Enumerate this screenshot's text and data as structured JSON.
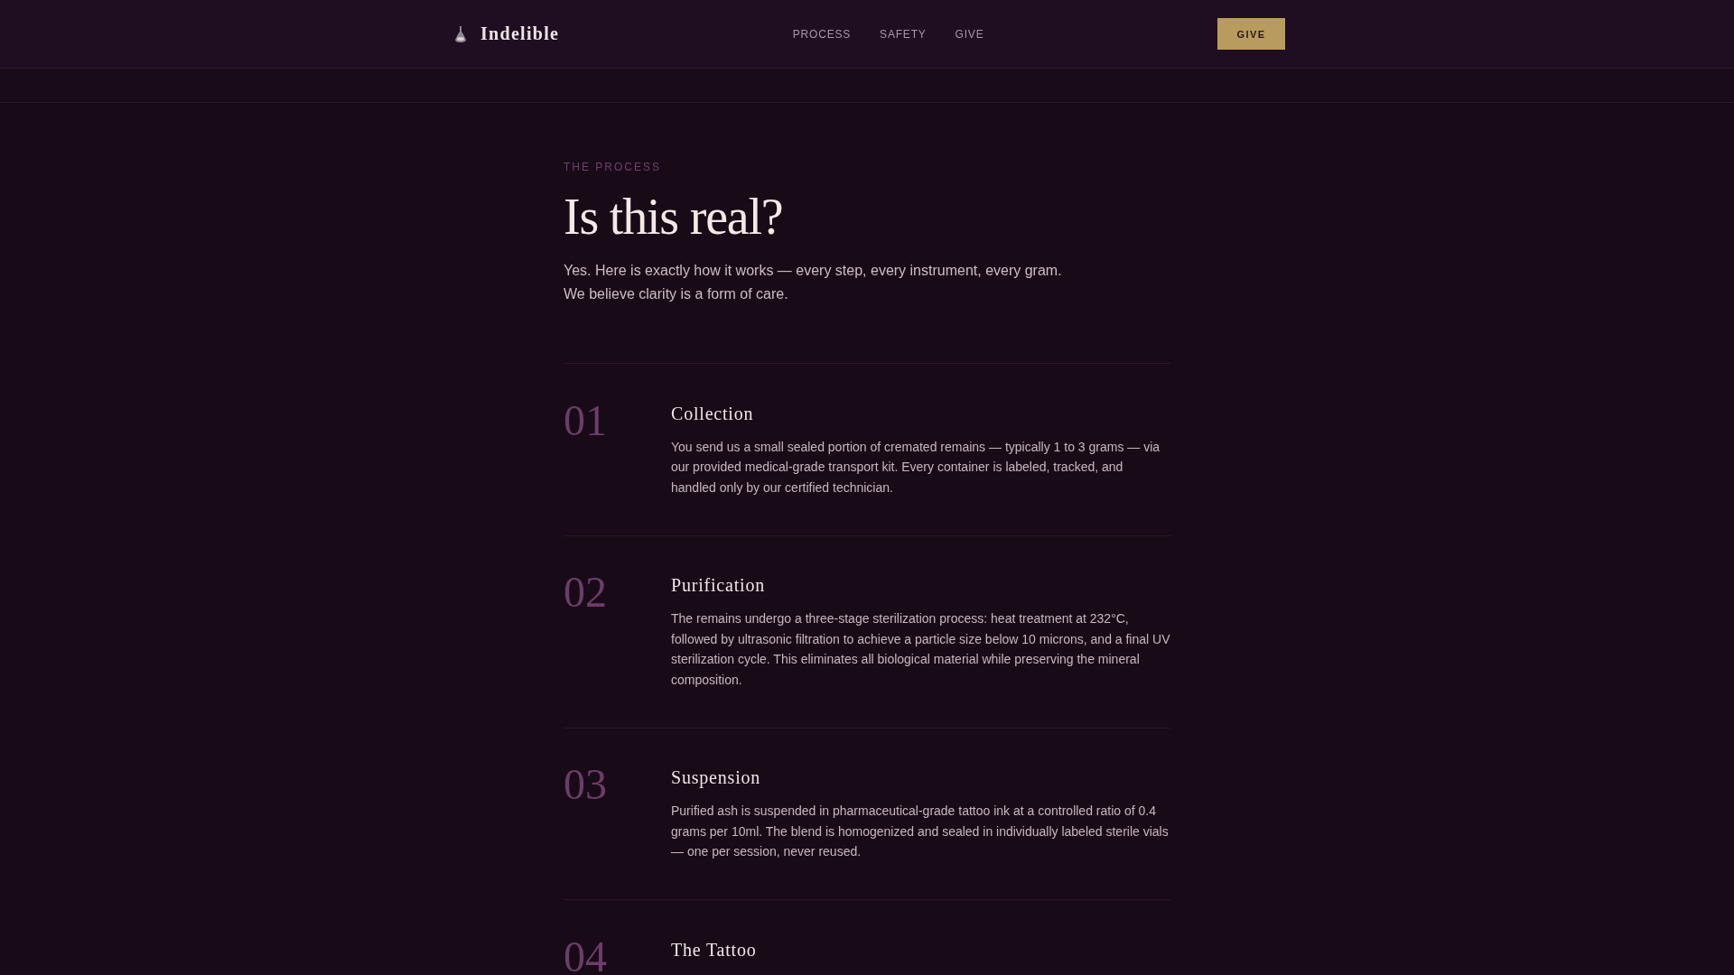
{
  "header": {
    "brand": "Indelible",
    "nav": [
      "PROCESS",
      "SAFETY",
      "GIVE"
    ],
    "cta": "GIVE"
  },
  "intro": {
    "eyebrow": "THE PROCESS",
    "title": "Is this real?",
    "lead": "Yes. Here is exactly how it works — every step, every instrument, every gram. We believe clarity is a form of care."
  },
  "steps": [
    {
      "number": "01",
      "title": "Collection",
      "body": "You send us a small sealed portion of cremated remains — typically 1 to 3 grams — via our provided medical-grade transport kit. Every container is labeled, tracked, and handled only by our certified technician."
    },
    {
      "number": "02",
      "title": "Purification",
      "body": "The remains undergo a three-stage sterilization process: heat treatment at 232°C, followed by ultrasonic filtration to achieve a particle size below 10 microns, and a final UV sterilization cycle. This eliminates all biological material while preserving the mineral composition."
    },
    {
      "number": "03",
      "title": "Suspension",
      "body": "Purified ash is suspended in pharmaceutical-grade tattoo ink at a controlled ratio of 0.4 grams per 10ml. The blend is homogenized and sealed in individually labeled sterile vials — one per session, never reused."
    },
    {
      "number": "04",
      "title": "The Tattoo"
    }
  ]
}
